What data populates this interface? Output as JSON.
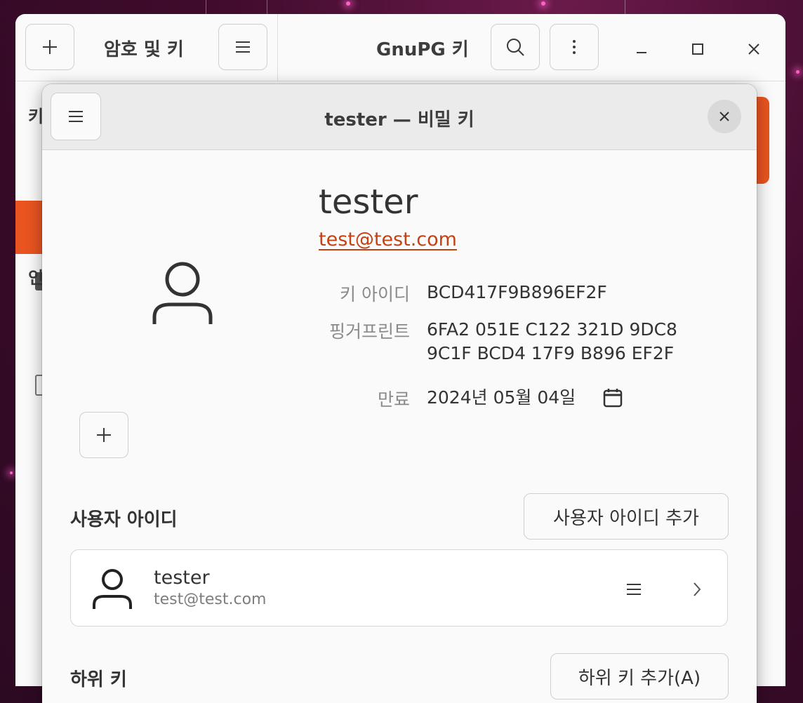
{
  "main_window": {
    "title_left": "암호 및 키",
    "title_right": "GnuPG 키",
    "sidebar_peek_top": "키",
    "sidebar_peek_bottom": "인"
  },
  "dialog": {
    "title": "tester — 비밀 키",
    "owner": {
      "name": "tester",
      "email": "test@test.com"
    },
    "details": {
      "key_id_label": "키 아이디",
      "key_id_value": "BCD417F9B896EF2F",
      "fingerprint_label": "핑거프린트",
      "fingerprint_line1": "6FA2 051E C122 321D 9DC8",
      "fingerprint_line2": "9C1F BCD4 17F9 B896 EF2F",
      "expires_label": "만료",
      "expires_value": "2024년 05월 04일"
    },
    "user_ids": {
      "section_title": "사용자 아이디",
      "add_button": "사용자 아이디 추가",
      "items": [
        {
          "name": "tester",
          "email": "test@test.com"
        }
      ]
    },
    "subkeys": {
      "section_title": "하위 키",
      "add_button": "하위 키 추가(A)"
    }
  },
  "colors": {
    "accent": "#e95420",
    "link": "#c34113",
    "desktop": "#3f0b2c"
  },
  "icons": [
    "plus-icon",
    "hamburger-menu-icon",
    "search-icon",
    "kebab-menu-icon",
    "minimize-icon",
    "maximize-icon",
    "close-icon",
    "user-avatar-icon",
    "calendar-icon",
    "chevron-right-icon"
  ]
}
